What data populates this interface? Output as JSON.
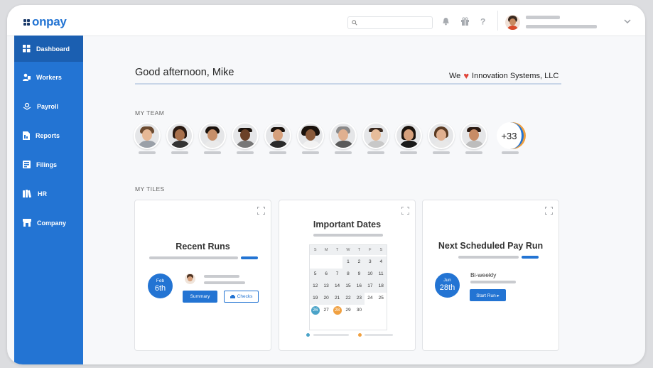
{
  "brand": {
    "name": "onpay",
    "accent": "#2374d3",
    "sidebar_active": "#1b5fb1"
  },
  "topbar": {
    "search_placeholder": "",
    "icons": [
      "search-icon",
      "bell-icon",
      "gift-icon",
      "help-icon",
      "chevron-down-icon"
    ]
  },
  "sidebar": {
    "items": [
      {
        "label": "Dashboard",
        "icon": "grid-icon",
        "active": true
      },
      {
        "label": "Workers",
        "icon": "workers-icon",
        "active": false
      },
      {
        "label": "Payroll",
        "icon": "payroll-icon",
        "active": false
      },
      {
        "label": "Reports",
        "icon": "reports-icon",
        "active": false
      },
      {
        "label": "Filings",
        "icon": "filings-icon",
        "active": false
      },
      {
        "label": "HR",
        "icon": "books-icon",
        "active": false
      },
      {
        "label": "Company",
        "icon": "store-icon",
        "active": false
      }
    ]
  },
  "main": {
    "greeting": "Good afternoon, Mike",
    "company_prefix": "We",
    "company_heart": "♥",
    "company_name": "Innovation Systems, LLC",
    "team_label": "MY TEAM",
    "team_more": "+33",
    "tiles_label": "MY TILES",
    "tiles": {
      "recent_runs": {
        "title": "Recent Runs",
        "date_month": "Feb",
        "date_day": "6th",
        "summary_button": "Summary",
        "checks_button": "Checks"
      },
      "important_dates": {
        "title": "Important Dates",
        "weekdays": [
          "S",
          "M",
          "T",
          "W",
          "T",
          "F",
          "S"
        ],
        "days": [
          "",
          "",
          "",
          "1",
          "2",
          "3",
          "4",
          "5",
          "6",
          "7",
          "8",
          "9",
          "10",
          "11",
          "12",
          "13",
          "14",
          "15",
          "16",
          "17",
          "18",
          "19",
          "20",
          "21",
          "22",
          "23",
          "24",
          "25",
          "26",
          "27",
          "28",
          "29",
          "30",
          ""
        ]
      },
      "next_pay_run": {
        "title": "Next Scheduled Pay Run",
        "date_month": "Jun",
        "date_day": "28th",
        "frequency": "Bi-weekly",
        "start_button": "Start Run ▸"
      }
    }
  }
}
